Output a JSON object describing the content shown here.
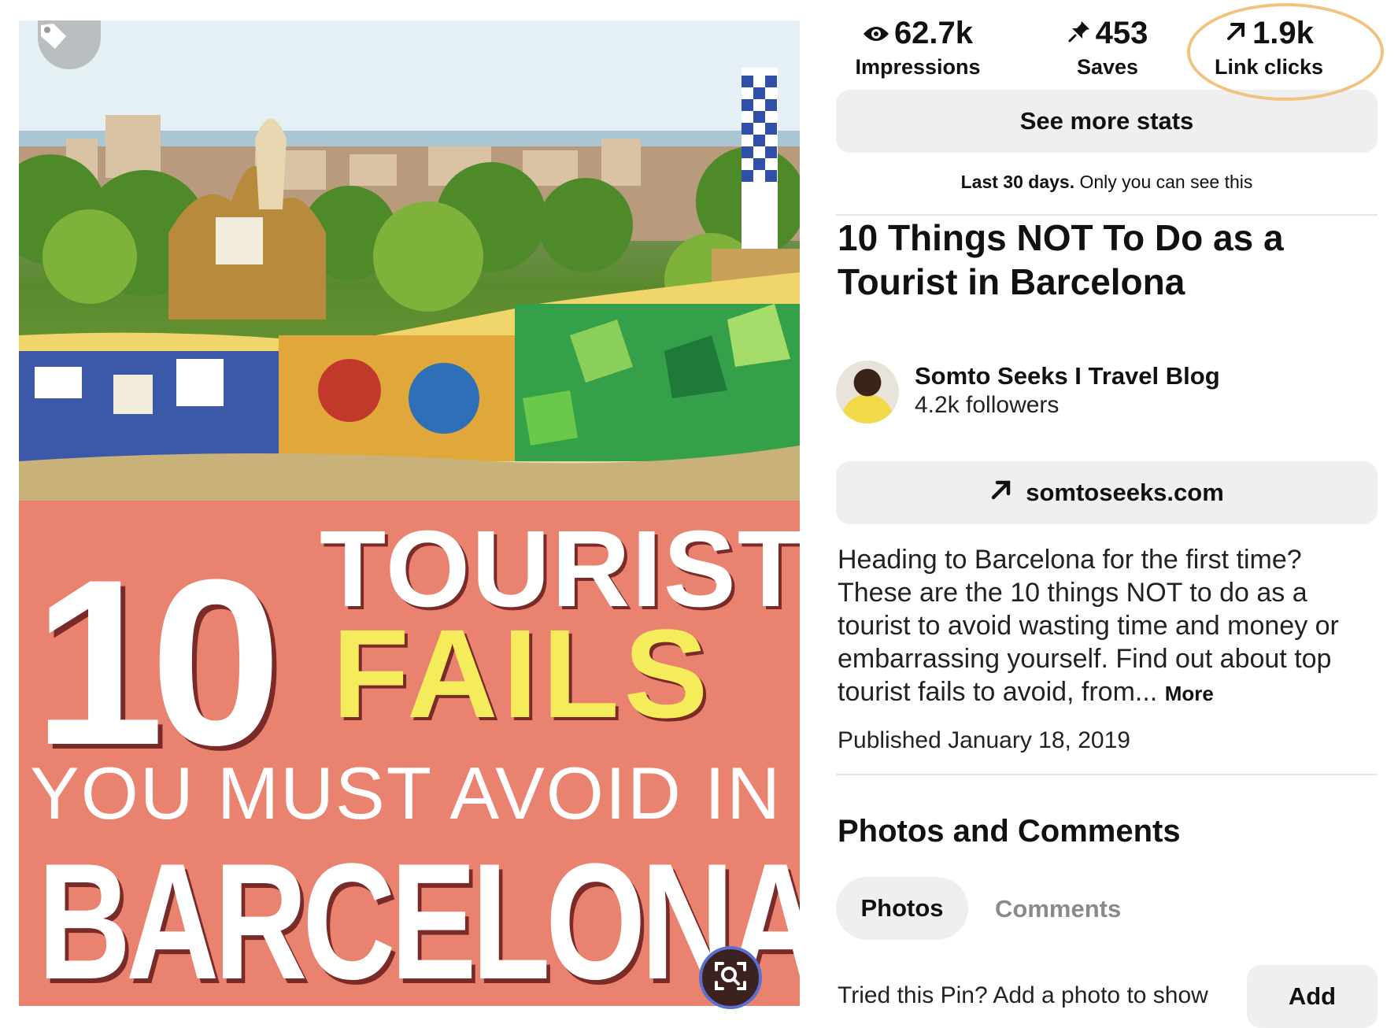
{
  "stats": {
    "impressions": {
      "value": "62.7k",
      "label": "Impressions",
      "icon": "eye-icon"
    },
    "saves": {
      "value": "453",
      "label": "Saves",
      "icon": "pin-icon"
    },
    "link_clicks": {
      "value": "1.9k",
      "label": "Link clicks",
      "icon": "arrow-up-right-icon"
    }
  },
  "see_more_label": "See more stats",
  "privacy_note": {
    "bold": "Last 30 days.",
    "text": "Only you can see this"
  },
  "pin": {
    "title": "10 Things NOT To Do as a Tourist in Barcelona",
    "image_text": {
      "number": "10",
      "line1": "TOURIST",
      "line2": "FAILS",
      "line3": "YOU MUST AVOID IN",
      "line4": "BARCELONA"
    }
  },
  "creator": {
    "name": "Somto Seeks I Travel Blog",
    "followers": "4.2k followers"
  },
  "website": {
    "label": "somtoseeks.com",
    "icon": "arrow-up-right-icon"
  },
  "description": {
    "text": "Heading to Barcelona for the first time? These are the 10 things NOT to do as a tourist to avoid wasting time and money or embarrassing yourself. Find out about top tourist fails to avoid, from...",
    "more_label": "More"
  },
  "published": "Published January 18, 2019",
  "section_title": "Photos and Comments",
  "tabs": [
    {
      "label": "Photos",
      "active": true
    },
    {
      "label": "Comments",
      "active": false
    }
  ],
  "tried_prompt": "Tried this Pin? Add a photo to show",
  "add_label": "Add",
  "colors": {
    "poster_bg": "#e9836f",
    "fails_yellow": "#f4ec5a",
    "highlight_ring": "#f2c27f",
    "button_grey": "#efefef"
  }
}
